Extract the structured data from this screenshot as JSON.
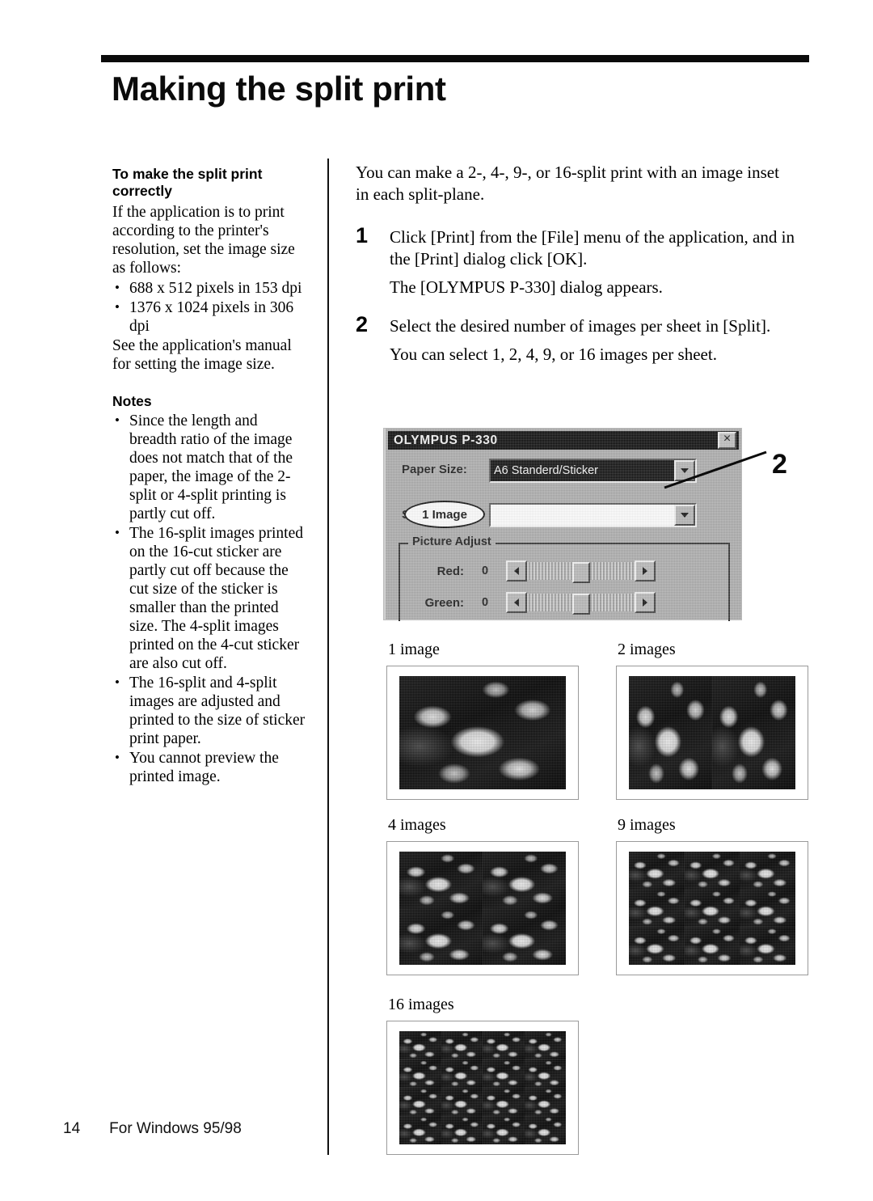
{
  "header": {
    "title": "Making the split print"
  },
  "left_column": {
    "section_heading": "To make the split print correctly",
    "intro_paragraph": "If the application is to print according to the printer's resolution, set the image size as follows:",
    "resolution_bullets": [
      "688 x 512 pixels in 153 dpi",
      "1376 x 1024 pixels in 306 dpi"
    ],
    "closing_paragraph": "See the application's manual for setting the image size.",
    "notes_heading": "Notes",
    "notes": [
      "Since the length and breadth ratio of the image does not match that of the paper, the image of the 2-split or 4-split printing is partly cut off.",
      "The 16-split images printed on the 16-cut sticker are partly cut off because the cut size of the sticker is smaller than the printed size. The 4-split images printed on the 4-cut sticker are also cut off.",
      "The 16-split and 4-split images are adjusted and printed to the size of sticker print paper.",
      "You cannot preview the printed image."
    ]
  },
  "right_column": {
    "intro": "You can make a 2-, 4-, 9-, or 16-split print with an image inset in each split-plane.",
    "steps": [
      {
        "number": "1",
        "body": "Click [Print] from the [File] menu of the application, and in the [Print] dialog click [OK].",
        "result": "The [OLYMPUS P-330] dialog appears."
      },
      {
        "number": "2",
        "body": "Select the desired number of images per sheet in [Split].",
        "result": "You can select 1, 2, 4, 9, or 16 images per sheet."
      }
    ],
    "callout_number": "2"
  },
  "dialog": {
    "title": "OLYMPUS P-330",
    "close_label": "✕",
    "paper_size_label": "Paper Size:",
    "paper_size_value": "A6 Standerd/Sticker",
    "split_label": "Split:",
    "split_value": "1 Image",
    "picture_adjust_label": "Picture Adjust",
    "adjustments": [
      {
        "name": "Red:",
        "value": "0"
      },
      {
        "name": "Green:",
        "value": "0"
      }
    ]
  },
  "samples": [
    {
      "label": "1 image",
      "cols": 1,
      "rows": 1
    },
    {
      "label": "2 images",
      "cols": 2,
      "rows": 1
    },
    {
      "label": "4 images",
      "cols": 2,
      "rows": 2
    },
    {
      "label": "9 images",
      "cols": 3,
      "rows": 3
    },
    {
      "label": "16 images",
      "cols": 4,
      "rows": 4
    }
  ],
  "footer": {
    "page_number": "14",
    "platform": "For Windows 95/98"
  }
}
